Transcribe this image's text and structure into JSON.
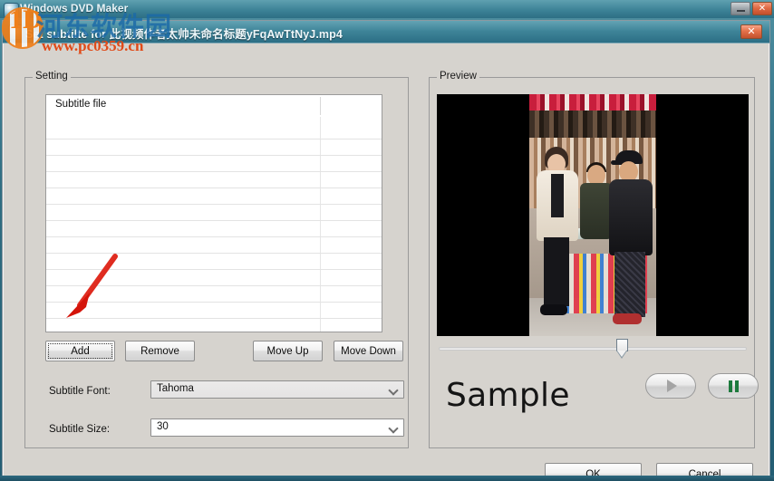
{
  "outer_window": {
    "title": "Windows DVD Maker",
    "app_icon": "dvd-disc-icon",
    "minimize_label": "–",
    "close_label": "✕"
  },
  "dialog": {
    "title": "Set subtilte for 此视频作者太帅未命名标题yFqAwTtNyJ.mp4",
    "icon": "dvd-disc-icon",
    "close_label": "✕"
  },
  "watermark": {
    "logo_char": "1D",
    "site_name_cn": "河东软件园",
    "site_url": "www.pc0359.cn"
  },
  "setting_group": {
    "legend": "Setting",
    "list": {
      "columns": [
        "Subtitle file",
        ""
      ],
      "rows": []
    },
    "buttons": {
      "add": "Add",
      "remove": "Remove",
      "move_up": "Move Up",
      "move_down": "Move Down"
    },
    "font_row": {
      "label": "Subtitle Font:",
      "value": "Tahoma"
    },
    "size_row": {
      "label": "Subtitle Size:",
      "value": "30"
    }
  },
  "preview_group": {
    "legend": "Preview",
    "sample_text": "Sample",
    "play_icon": "play-icon",
    "pause_icon": "pause-icon",
    "seek_position_percent": 58
  },
  "footer": {
    "ok": "OK",
    "cancel": "Cancel"
  },
  "colors": {
    "titlebar": "#3e8498",
    "dialog_face": "#d6d3ce",
    "close_button": "#e4714a",
    "pause_green": "#1d7a3c",
    "watermark_blue": "#1b6aa8",
    "watermark_orange": "#e04a18",
    "arrow_red": "#e01b10"
  }
}
